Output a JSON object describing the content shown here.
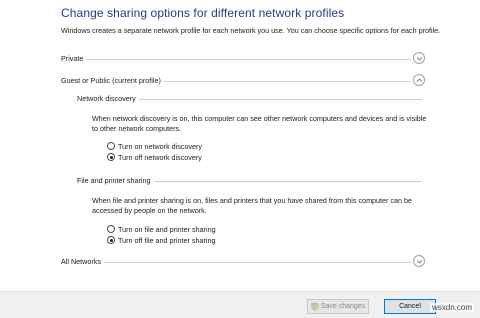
{
  "header": {
    "title": "Change sharing options for different network profiles",
    "description": "Windows creates a separate network profile for each network you use. You can choose specific options for each profile."
  },
  "profiles": {
    "private": {
      "label": "Private",
      "state": "collapsed"
    },
    "guest_public": {
      "label": "Guest or Public (current profile)",
      "state": "expanded"
    },
    "all_networks": {
      "label": "All Networks",
      "state": "collapsed"
    }
  },
  "network_discovery": {
    "heading": "Network discovery",
    "description": "When network discovery is on, this computer can see other network computers and devices and is visible to other network computers.",
    "options": [
      {
        "label": "Turn on network discovery",
        "selected": false
      },
      {
        "label": "Turn off network discovery",
        "selected": true
      }
    ]
  },
  "file_printer_sharing": {
    "heading": "File and printer sharing",
    "description": "When file and printer sharing is on, files and printers that you have shared from this computer can be accessed by people on the network.",
    "options": [
      {
        "label": "Turn on file and printer sharing",
        "selected": false
      },
      {
        "label": "Turn off file and printer sharing",
        "selected": true
      }
    ]
  },
  "footer": {
    "save_label": "Save changes",
    "cancel_label": "Cancel"
  },
  "watermark": "wsxdn.com",
  "colors": {
    "title": "#1f3d8a",
    "focus_border": "#0078d7"
  }
}
